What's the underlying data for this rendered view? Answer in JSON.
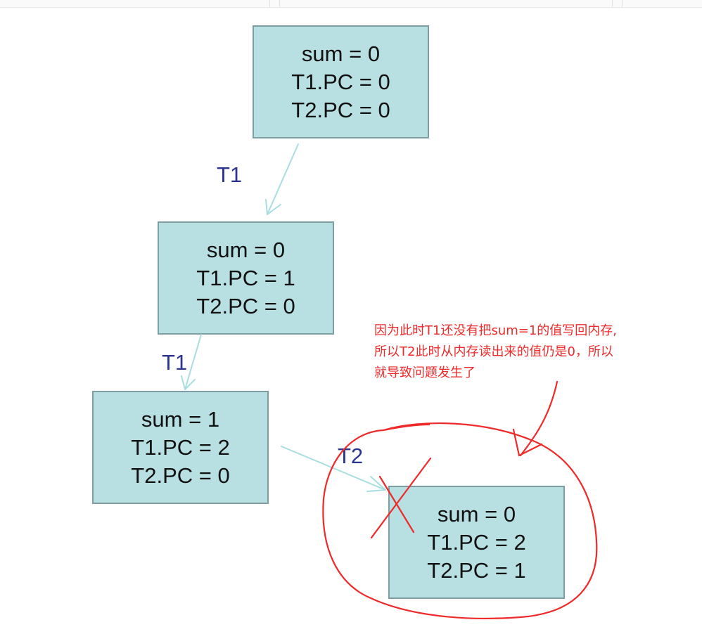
{
  "nodes": [
    {
      "id": "s0",
      "lines": [
        "sum = 0",
        "T1.PC = 0",
        "T2.PC = 0"
      ]
    },
    {
      "id": "s1",
      "lines": [
        "sum = 0",
        "T1.PC = 1",
        "T2.PC = 0"
      ]
    },
    {
      "id": "s2",
      "lines": [
        "sum = 1",
        "T1.PC = 2",
        "T2.PC = 0"
      ]
    },
    {
      "id": "s3",
      "lines": [
        "sum = 0",
        "T1.PC = 2",
        "T2.PC = 1"
      ]
    }
  ],
  "edges": [
    {
      "from": "s0",
      "to": "s1",
      "label": "T1"
    },
    {
      "from": "s1",
      "to": "s2",
      "label": "T1"
    },
    {
      "from": "s2",
      "to": "s3",
      "label": "T2"
    }
  ],
  "annotation": {
    "lines": [
      "因为此时T1还没有把sum=1的值写回内存,",
      "所以T2此时从内存读出来的值仍是0，所以",
      "就导致问题发生了"
    ],
    "color": "#ee2a2a"
  },
  "colors": {
    "box_fill": "#b8dfe1",
    "box_border": "#7f9ea4",
    "edge": "#a9dde0",
    "edge_label": "#2b3590"
  }
}
